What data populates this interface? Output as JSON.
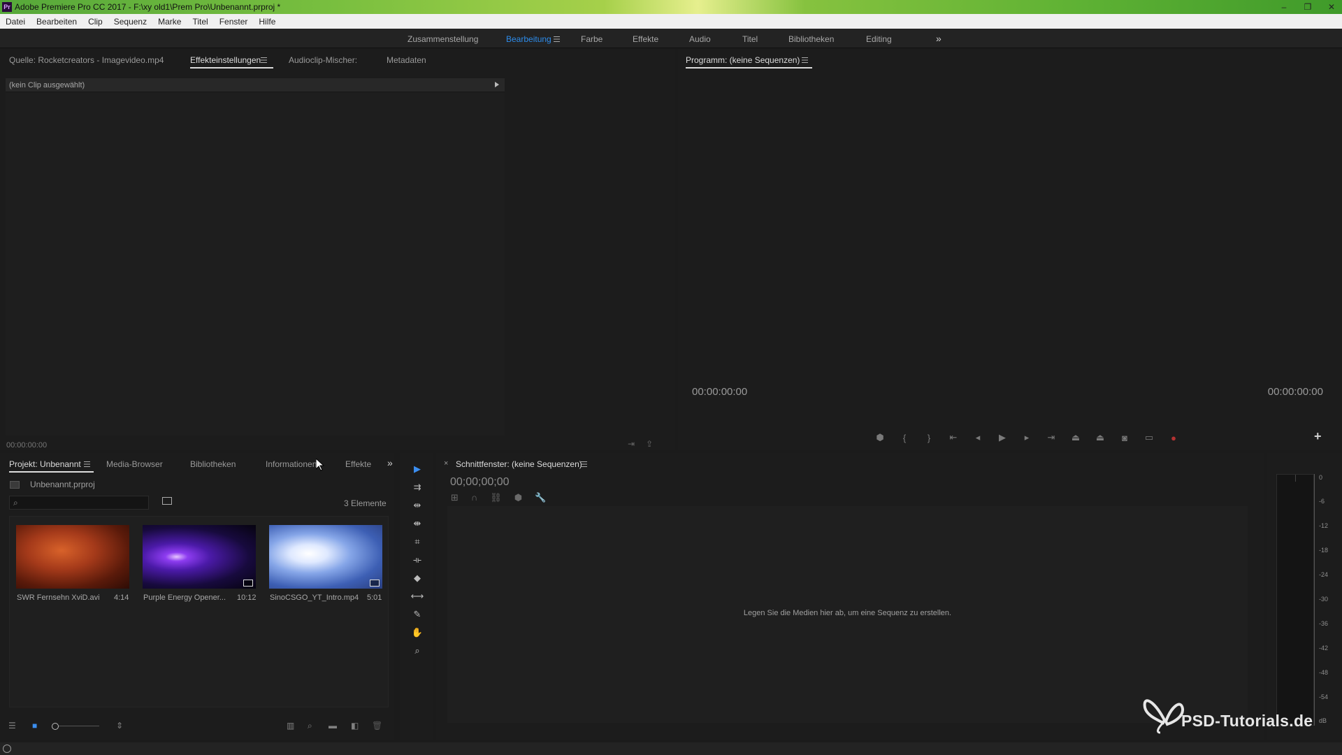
{
  "window": {
    "title": "Adobe Premiere Pro CC 2017 - F:\\xy old1\\Prem Pro\\Unbenannt.prproj *",
    "logo": "Pr",
    "controls": [
      "–",
      "❐",
      "✕"
    ]
  },
  "menu": [
    "Datei",
    "Bearbeiten",
    "Clip",
    "Sequenz",
    "Marke",
    "Titel",
    "Fenster",
    "Hilfe"
  ],
  "workspaces": {
    "items": [
      "Zusammenstellung",
      "Bearbeitung",
      "Farbe",
      "Effekte",
      "Audio",
      "Titel",
      "Bibliotheken",
      "Editing"
    ],
    "active": "Bearbeitung",
    "overflow": "»"
  },
  "source_panel": {
    "tabs": [
      "Quelle: Rocketcreators - Imagevideo.mp4",
      "Effekteinstellungen",
      "Audioclip-Mischer:",
      "Metadaten"
    ],
    "active_tab": "Effekteinstellungen",
    "no_clip": "(kein Clip ausgewählt)",
    "timecode": "00:00:00:00"
  },
  "program_panel": {
    "title": "Programm: (keine Sequenzen)",
    "timecode_left": "00:00:00:00",
    "timecode_right": "00:00:00:00",
    "plus": "+"
  },
  "project_panel": {
    "tabs": [
      "Projekt: Unbenannt",
      "Media-Browser",
      "Bibliotheken",
      "Informationen",
      "Effekte"
    ],
    "active_tab": "Projekt: Unbenannt",
    "overflow": "»",
    "file": "Unbenannt.prproj",
    "count": "3 Elemente",
    "items": [
      {
        "name": "SWR Fernsehn XviD.avi",
        "duration": "4:14"
      },
      {
        "name": "Purple Energy Opener...",
        "duration": "10:12"
      },
      {
        "name": "SinoCSGO_YT_Intro.mp4",
        "duration": "5:01"
      }
    ]
  },
  "timeline_panel": {
    "title": "Schnittfenster: (keine Sequenzen)",
    "close": "×",
    "timecode": "00;00;00;00",
    "drop_hint": "Legen Sie die Medien hier ab, um eine Sequenz zu erstellen."
  },
  "tools": [
    "selection-tool",
    "track-select-tool",
    "ripple-edit-tool",
    "rolling-edit-tool",
    "rate-stretch-tool",
    "razor-tool",
    "slip-tool",
    "slide-tool",
    "pen-tool",
    "hand-tool",
    "zoom-tool"
  ],
  "audio_meter": {
    "ticks": [
      "0",
      "-6",
      "-12",
      "-18",
      "-24",
      "-30",
      "-36",
      "-42",
      "-48",
      "-54",
      "dB"
    ]
  },
  "watermark": {
    "text": "PSD-Tutorials.de"
  },
  "colors": {
    "accent_blue": "#2d8ceb",
    "record_red": "#b43232",
    "title_green": "#79bf3f"
  }
}
